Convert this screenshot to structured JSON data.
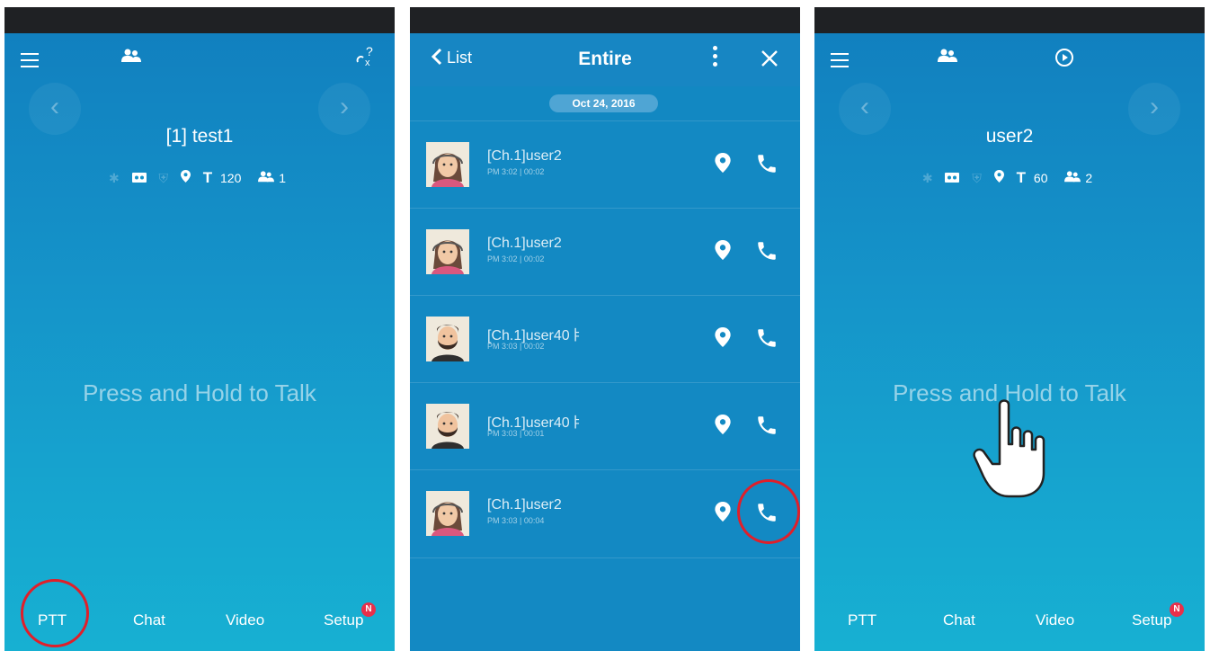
{
  "panel1": {
    "channel_title": "[1] test1",
    "tx_value": "120",
    "members_count": "1",
    "press_text": "Press and Hold to Talk",
    "tabs": [
      "PTT",
      "Chat",
      "Video",
      "Setup"
    ],
    "badge": "N"
  },
  "panel2": {
    "back_label": "List",
    "title": "Entire",
    "date": "Oct 24, 2016",
    "calls": [
      {
        "name": "[Ch.1]user2",
        "time": "PM 3:02 | 00:02",
        "avatar": "female"
      },
      {
        "name": "[Ch.1]user2",
        "time": "PM 3:02 | 00:02",
        "avatar": "female"
      },
      {
        "name": "[Ch.1]user40ㅑ",
        "time": "PM 3:03 | 00:02",
        "avatar": "male"
      },
      {
        "name": "[Ch.1]user40ㅑ",
        "time": "PM 3:03 | 00:01",
        "avatar": "male"
      },
      {
        "name": "[Ch.1]user2",
        "time": "PM 3:03 | 00:04",
        "avatar": "female"
      }
    ]
  },
  "panel3": {
    "channel_title": "user2",
    "tx_value": "60",
    "members_count": "2",
    "press_text": "Press and Hold to Talk",
    "tabs": [
      "PTT",
      "Chat",
      "Video",
      "Setup"
    ],
    "badge": "N"
  },
  "colors": {
    "accent_red": "#e01f2a",
    "badge_red": "#e8304a",
    "bg_blue": "#1389c3"
  }
}
